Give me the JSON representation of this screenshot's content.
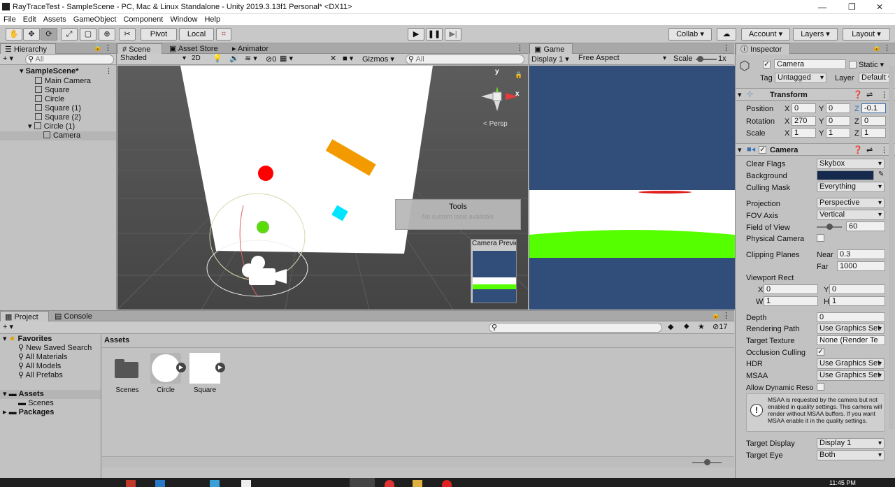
{
  "window": {
    "title": "RayTraceTest - SampleScene - PC, Mac & Linux Standalone - Unity 2019.3.13f1 Personal* <DX11>"
  },
  "menu": [
    "File",
    "Edit",
    "Assets",
    "GameObject",
    "Component",
    "Window",
    "Help"
  ],
  "toolbar": {
    "pivot": "Pivot",
    "local": "Local",
    "collab": "Collab",
    "account": "Account",
    "layers": "Layers",
    "layout": "Layout"
  },
  "hierarchy": {
    "tab": "Hierarchy",
    "search_placeholder": "All",
    "scene": "SampleScene*",
    "items": [
      "Main Camera",
      "Square",
      "Circle",
      "Square (1)",
      "Square (2)",
      "Circle (1)",
      "Camera"
    ]
  },
  "scene": {
    "tabs": [
      "Scene",
      "Asset Store",
      "Animator"
    ],
    "shading": "Shaded",
    "mode2d": "2D",
    "fx_count": "0",
    "gizmos": "Gizmos",
    "search_placeholder": "All",
    "persp": "< Persp",
    "axis_y": "y",
    "axis_x": "x",
    "tools_title": "Tools",
    "tools_msg": "No custom tools available",
    "preview_title": "Camera Preview"
  },
  "game": {
    "tab": "Game",
    "display": "Display 1",
    "aspect": "Free Aspect",
    "scale_label": "Scale",
    "scale_value": "1x"
  },
  "project": {
    "tabs": [
      "Project",
      "Console"
    ],
    "favorites": "Favorites",
    "fav_items": [
      "New Saved Search",
      "All Materials",
      "All Models",
      "All Prefabs"
    ],
    "assets": "Assets",
    "asset_children": [
      "Scenes"
    ],
    "packages": "Packages",
    "breadcrumb": "Assets",
    "files": [
      "Scenes",
      "Circle",
      "Square"
    ],
    "hidden_count": "17"
  },
  "inspector": {
    "tab": "Inspector",
    "name": "Camera",
    "static": "Static",
    "tag_label": "Tag",
    "tag": "Untagged",
    "layer_label": "Layer",
    "layer": "Default",
    "transform": {
      "title": "Transform",
      "position": {
        "label": "Position",
        "x": "0",
        "y": "0",
        "z": "-0.1"
      },
      "rotation": {
        "label": "Rotation",
        "x": "270",
        "y": "0",
        "z": "0"
      },
      "scale": {
        "label": "Scale",
        "x": "1",
        "y": "1",
        "z": "1"
      }
    },
    "camera": {
      "title": "Camera",
      "rows": [
        {
          "label": "Clear Flags",
          "value": "Skybox"
        },
        {
          "label": "Background",
          "value": ""
        },
        {
          "label": "Culling Mask",
          "value": "Everything"
        },
        {
          "label": "Projection",
          "value": "Perspective"
        },
        {
          "label": "FOV Axis",
          "value": "Vertical"
        },
        {
          "label": "Field of View",
          "value": "60"
        },
        {
          "label": "Physical Camera",
          "value": ""
        },
        {
          "label": "Clipping Planes",
          "value": ""
        }
      ],
      "near_label": "Near",
      "near": "0.3",
      "far_label": "Far",
      "far": "1000",
      "viewport_label": "Viewport Rect",
      "vx": "0",
      "vy": "0",
      "vw": "1",
      "vh": "1",
      "depth_label": "Depth",
      "depth": "0",
      "rendering_path_label": "Rendering Path",
      "rendering_path": "Use Graphics Set",
      "target_texture_label": "Target Texture",
      "target_texture": "None (Render Te",
      "occlusion_label": "Occlusion Culling",
      "hdr_label": "HDR",
      "hdr": "Use Graphics Set",
      "msaa_label": "MSAA",
      "msaa": "Use Graphics Set",
      "dyn_label": "Allow Dynamic Reso",
      "warning": "MSAA is requested by the camera but not enabled in quality settings. This camera will render without MSAA buffers. If you want MSAA enable it in the quality settings.",
      "target_display_label": "Target Display",
      "target_display": "Display 1",
      "target_eye_label": "Target Eye",
      "target_eye": "Both"
    }
  },
  "clock": "11:45 PM",
  "colors": {
    "accent": "#3a72b0",
    "game_sky": "#314d79",
    "green": "#55ff00",
    "orange": "#f39a00",
    "red": "#ff0000",
    "cyan": "#00e5ff"
  }
}
